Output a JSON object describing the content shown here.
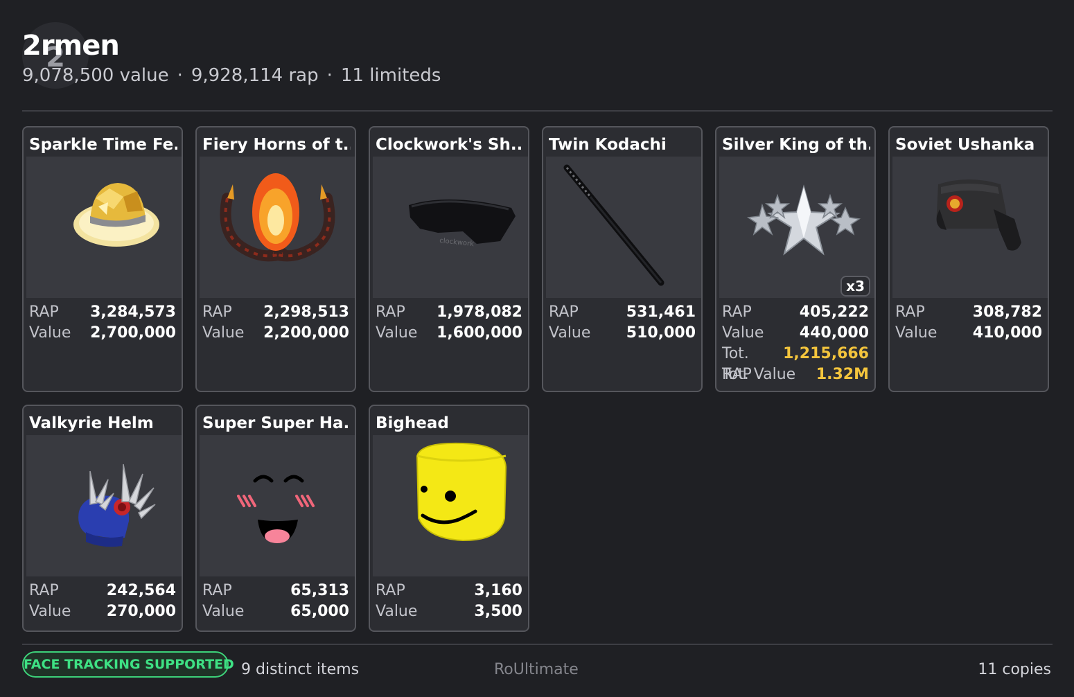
{
  "profile": {
    "avatar_letter": "2",
    "username": "2rmen",
    "value_text": "9,078,500 value",
    "rap_text": "9,928,114 rap",
    "limiteds_text": "11 limiteds",
    "separator": "·"
  },
  "items": [
    {
      "title": "Sparkle Time Fe...",
      "icon": "sparkle-time-fedora-icon",
      "rap_label": "RAP",
      "rap": "3,284,573",
      "value_label": "Value",
      "value": "2,700,000"
    },
    {
      "title": "Fiery Horns of t...",
      "icon": "fiery-horns-icon",
      "rap_label": "RAP",
      "rap": "2,298,513",
      "value_label": "Value",
      "value": "2,200,000"
    },
    {
      "title": "Clockwork's Sh...",
      "icon": "clockwork-shades-icon",
      "rap_label": "RAP",
      "rap": "1,978,082",
      "value_label": "Value",
      "value": "1,600,000"
    },
    {
      "title": "Twin Kodachi",
      "icon": "twin-kodachi-icon",
      "rap_label": "RAP",
      "rap": "531,461",
      "value_label": "Value",
      "value": "510,000"
    },
    {
      "title": "Silver King of th...",
      "icon": "silver-king-crown-icon",
      "quantity": "x3",
      "rap_label": "RAP",
      "rap": "405,222",
      "value_label": "Value",
      "value": "440,000",
      "tot_rap_label": "Tot. RAP",
      "tot_rap": "1,215,666",
      "tot_value_label": "Tot. Value",
      "tot_value": "1.32M"
    },
    {
      "title": "Soviet Ushanka",
      "icon": "soviet-ushanka-icon",
      "rap_label": "RAP",
      "rap": "308,782",
      "value_label": "Value",
      "value": "410,000"
    },
    {
      "title": "Valkyrie Helm",
      "icon": "valkyrie-helm-icon",
      "rap_label": "RAP",
      "rap": "242,564",
      "value_label": "Value",
      "value": "270,000"
    },
    {
      "title": "Super Super Ha...",
      "icon": "super-happy-face-icon",
      "rap_label": "RAP",
      "rap": "65,313",
      "value_label": "Value",
      "value": "65,000"
    },
    {
      "title": "Bighead",
      "icon": "bighead-icon",
      "rap_label": "RAP",
      "rap": "3,160",
      "value_label": "Value",
      "value": "3,500"
    }
  ],
  "footer": {
    "badge": "FACE TRACKING SUPPORTED",
    "distinct_items": "9 distinct items",
    "brand": "RoUltimate",
    "copies": "11 copies"
  },
  "colors": {
    "background": "#1f2024",
    "card": "#2c2d32",
    "highlight_gold": "#f4c53d",
    "badge_green": "#3ee184"
  }
}
